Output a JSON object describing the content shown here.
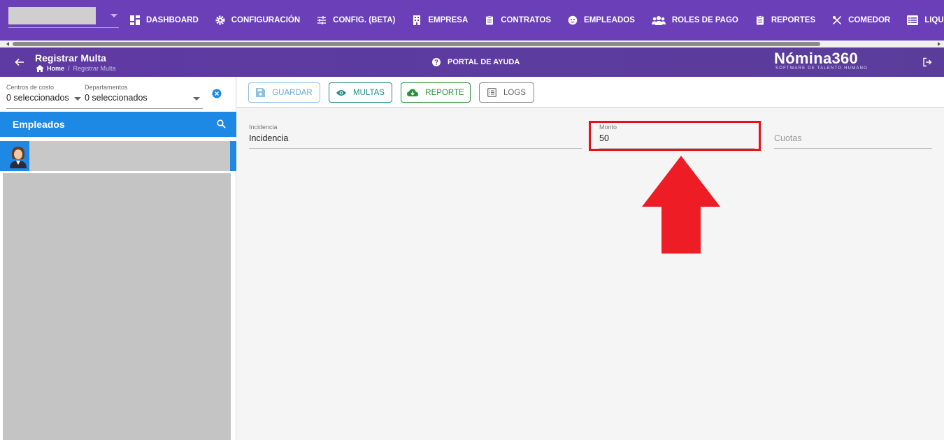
{
  "topnav": {
    "items": [
      {
        "label": "DASHBOARD",
        "icon": "dashboard-icon"
      },
      {
        "label": "CONFIGURACIÓN",
        "icon": "gear-icon"
      },
      {
        "label": "CONFIG. (BETA)",
        "icon": "tune-icon"
      },
      {
        "label": "EMPRESA",
        "icon": "building-icon"
      },
      {
        "label": "CONTRATOS",
        "icon": "clipboard-icon"
      },
      {
        "label": "EMPLEADOS",
        "icon": "face-icon"
      },
      {
        "label": "ROLES DE PAGO",
        "icon": "group-icon"
      },
      {
        "label": "REPORTES",
        "icon": "clipboard-icon"
      },
      {
        "label": "COMEDOR",
        "icon": "utensils-icon"
      },
      {
        "label": "LIQUIDACIONES",
        "icon": "list-icon"
      }
    ]
  },
  "subbar": {
    "title": "Registrar Multa",
    "breadcrumb_home": "Home",
    "breadcrumb_sep": "/",
    "breadcrumb_current": "Registrar Multa",
    "help_label": "PORTAL DE AYUDA",
    "brand_name": "Nómina360",
    "brand_tagline": "SOFTWARE DE TALENTO HUMANO"
  },
  "filters": {
    "cost_centers_label": "Centros de costo",
    "cost_centers_value": "0 seleccionados",
    "departments_label": "Departamentos",
    "departments_value": "0 seleccionados"
  },
  "employees": {
    "header": "Empleados"
  },
  "toolbar": {
    "save_label": "GUARDAR",
    "multas_label": "MULTAS",
    "reporte_label": "REPORTE",
    "logs_label": "LOGS"
  },
  "form": {
    "incidencia_label": "Incidencia",
    "incidencia_value": "Incidencia",
    "monto_label": "Monto",
    "monto_value": "50",
    "cuotas_placeholder": "Cuotas"
  },
  "colors": {
    "nav_bg": "#6a3fb8",
    "accent_blue": "#1e88e5",
    "highlight_red": "#e8111a"
  }
}
